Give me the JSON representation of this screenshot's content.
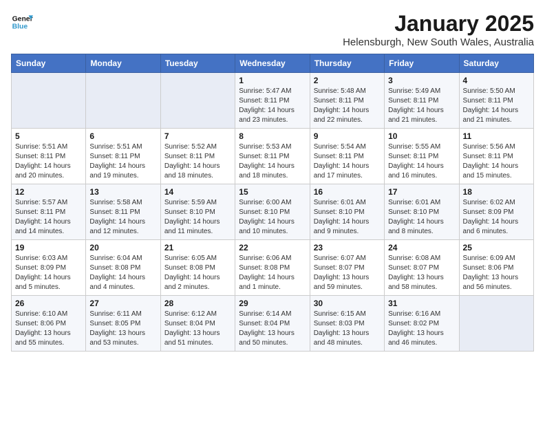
{
  "header": {
    "logo_line1": "General",
    "logo_line2": "Blue",
    "title": "January 2025",
    "subtitle": "Helensburgh, New South Wales, Australia"
  },
  "weekdays": [
    "Sunday",
    "Monday",
    "Tuesday",
    "Wednesday",
    "Thursday",
    "Friday",
    "Saturday"
  ],
  "weeks": [
    [
      {
        "day": "",
        "info": ""
      },
      {
        "day": "",
        "info": ""
      },
      {
        "day": "",
        "info": ""
      },
      {
        "day": "1",
        "info": "Sunrise: 5:47 AM\nSunset: 8:11 PM\nDaylight: 14 hours\nand 23 minutes."
      },
      {
        "day": "2",
        "info": "Sunrise: 5:48 AM\nSunset: 8:11 PM\nDaylight: 14 hours\nand 22 minutes."
      },
      {
        "day": "3",
        "info": "Sunrise: 5:49 AM\nSunset: 8:11 PM\nDaylight: 14 hours\nand 21 minutes."
      },
      {
        "day": "4",
        "info": "Sunrise: 5:50 AM\nSunset: 8:11 PM\nDaylight: 14 hours\nand 21 minutes."
      }
    ],
    [
      {
        "day": "5",
        "info": "Sunrise: 5:51 AM\nSunset: 8:11 PM\nDaylight: 14 hours\nand 20 minutes."
      },
      {
        "day": "6",
        "info": "Sunrise: 5:51 AM\nSunset: 8:11 PM\nDaylight: 14 hours\nand 19 minutes."
      },
      {
        "day": "7",
        "info": "Sunrise: 5:52 AM\nSunset: 8:11 PM\nDaylight: 14 hours\nand 18 minutes."
      },
      {
        "day": "8",
        "info": "Sunrise: 5:53 AM\nSunset: 8:11 PM\nDaylight: 14 hours\nand 18 minutes."
      },
      {
        "day": "9",
        "info": "Sunrise: 5:54 AM\nSunset: 8:11 PM\nDaylight: 14 hours\nand 17 minutes."
      },
      {
        "day": "10",
        "info": "Sunrise: 5:55 AM\nSunset: 8:11 PM\nDaylight: 14 hours\nand 16 minutes."
      },
      {
        "day": "11",
        "info": "Sunrise: 5:56 AM\nSunset: 8:11 PM\nDaylight: 14 hours\nand 15 minutes."
      }
    ],
    [
      {
        "day": "12",
        "info": "Sunrise: 5:57 AM\nSunset: 8:11 PM\nDaylight: 14 hours\nand 14 minutes."
      },
      {
        "day": "13",
        "info": "Sunrise: 5:58 AM\nSunset: 8:11 PM\nDaylight: 14 hours\nand 12 minutes."
      },
      {
        "day": "14",
        "info": "Sunrise: 5:59 AM\nSunset: 8:10 PM\nDaylight: 14 hours\nand 11 minutes."
      },
      {
        "day": "15",
        "info": "Sunrise: 6:00 AM\nSunset: 8:10 PM\nDaylight: 14 hours\nand 10 minutes."
      },
      {
        "day": "16",
        "info": "Sunrise: 6:01 AM\nSunset: 8:10 PM\nDaylight: 14 hours\nand 9 minutes."
      },
      {
        "day": "17",
        "info": "Sunrise: 6:01 AM\nSunset: 8:10 PM\nDaylight: 14 hours\nand 8 minutes."
      },
      {
        "day": "18",
        "info": "Sunrise: 6:02 AM\nSunset: 8:09 PM\nDaylight: 14 hours\nand 6 minutes."
      }
    ],
    [
      {
        "day": "19",
        "info": "Sunrise: 6:03 AM\nSunset: 8:09 PM\nDaylight: 14 hours\nand 5 minutes."
      },
      {
        "day": "20",
        "info": "Sunrise: 6:04 AM\nSunset: 8:08 PM\nDaylight: 14 hours\nand 4 minutes."
      },
      {
        "day": "21",
        "info": "Sunrise: 6:05 AM\nSunset: 8:08 PM\nDaylight: 14 hours\nand 2 minutes."
      },
      {
        "day": "22",
        "info": "Sunrise: 6:06 AM\nSunset: 8:08 PM\nDaylight: 14 hours\nand 1 minute."
      },
      {
        "day": "23",
        "info": "Sunrise: 6:07 AM\nSunset: 8:07 PM\nDaylight: 13 hours\nand 59 minutes."
      },
      {
        "day": "24",
        "info": "Sunrise: 6:08 AM\nSunset: 8:07 PM\nDaylight: 13 hours\nand 58 minutes."
      },
      {
        "day": "25",
        "info": "Sunrise: 6:09 AM\nSunset: 8:06 PM\nDaylight: 13 hours\nand 56 minutes."
      }
    ],
    [
      {
        "day": "26",
        "info": "Sunrise: 6:10 AM\nSunset: 8:06 PM\nDaylight: 13 hours\nand 55 minutes."
      },
      {
        "day": "27",
        "info": "Sunrise: 6:11 AM\nSunset: 8:05 PM\nDaylight: 13 hours\nand 53 minutes."
      },
      {
        "day": "28",
        "info": "Sunrise: 6:12 AM\nSunset: 8:04 PM\nDaylight: 13 hours\nand 51 minutes."
      },
      {
        "day": "29",
        "info": "Sunrise: 6:14 AM\nSunset: 8:04 PM\nDaylight: 13 hours\nand 50 minutes."
      },
      {
        "day": "30",
        "info": "Sunrise: 6:15 AM\nSunset: 8:03 PM\nDaylight: 13 hours\nand 48 minutes."
      },
      {
        "day": "31",
        "info": "Sunrise: 6:16 AM\nSunset: 8:02 PM\nDaylight: 13 hours\nand 46 minutes."
      },
      {
        "day": "",
        "info": ""
      }
    ]
  ]
}
